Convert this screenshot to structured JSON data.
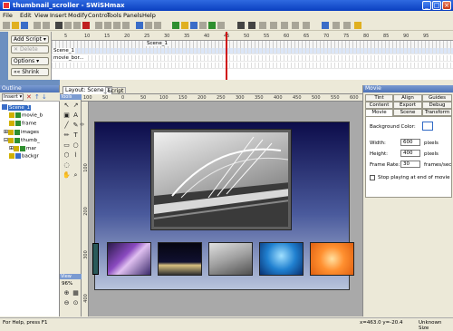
{
  "window": {
    "title": "thumbnail_scroller - SWiSHmax"
  },
  "menu": [
    "File",
    "Edit",
    "View",
    "Insert",
    "Modify",
    "Control",
    "Tools",
    "Panels",
    "Help"
  ],
  "timeline": {
    "add_script": "Add Script",
    "delete": "Delete",
    "options": "Options",
    "shrink": "Shrink",
    "scene_label": "Scene_1",
    "rows": [
      "Scene_1",
      "movie_bor..."
    ],
    "ruler_ticks": [
      "5",
      "10",
      "15",
      "20",
      "25",
      "30",
      "35",
      "40",
      "45",
      "50",
      "55",
      "60",
      "65",
      "70",
      "75",
      "80",
      "85",
      "90",
      "95"
    ]
  },
  "outline": {
    "title": "Outline",
    "insert": "Insert",
    "tree": [
      {
        "label": "Scene_1",
        "indent": 0
      },
      {
        "label": "movie_b",
        "indent": 1
      },
      {
        "label": "frame",
        "indent": 1
      },
      {
        "label": "images",
        "indent": 1
      },
      {
        "label": "thumb_",
        "indent": 1
      },
      {
        "label": "mar",
        "indent": 2
      },
      {
        "label": "backgr",
        "indent": 1
      }
    ]
  },
  "stage": {
    "tabs": [
      "Layout: Scene_1",
      "Script"
    ],
    "tools_label": "Tools",
    "view_label": "View",
    "zoom": "96%",
    "hruler": [
      "100",
      "50",
      "0",
      "50",
      "100",
      "150",
      "200",
      "250",
      "300",
      "350",
      "400",
      "450",
      "500",
      "550",
      "600"
    ],
    "vruler": [
      "0",
      "100",
      "200",
      "300",
      "400"
    ]
  },
  "movie_panel": {
    "title": "Movie",
    "tabs_row1": [
      "Tint",
      "Align",
      "Guides"
    ],
    "tabs_row2": [
      "Content",
      "Export",
      "Debug"
    ],
    "tabs_row3": [
      "Movie",
      "Scene",
      "Transform"
    ],
    "bg_color_label": "Background Color:",
    "width_label": "Width:",
    "width_value": "600",
    "width_unit": "pixels",
    "height_label": "Height:",
    "height_value": "400",
    "height_unit": "pixels",
    "framerate_label": "Frame Rate:",
    "framerate_value": "30",
    "framerate_unit": "frames/sec",
    "stop_label": "Stop playing at end of movie"
  },
  "status": {
    "help": "For Help, press F1",
    "coords": "x=463.0 y=-20.4",
    "size": "Unknown Size"
  }
}
